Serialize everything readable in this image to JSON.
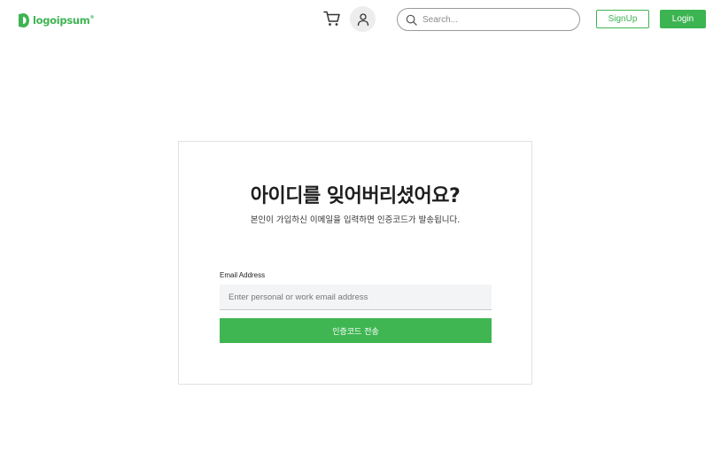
{
  "header": {
    "logo_text": "logoipsum",
    "logo_mark": "®",
    "cart_icon": "cart-icon",
    "user_icon": "user-icon",
    "search": {
      "placeholder": "Search...",
      "value": "",
      "icon": "search-icon"
    },
    "signup_label": "SignUp",
    "login_label": "Login"
  },
  "form": {
    "title": "아이디를 잊어버리셨어요?",
    "subtitle": "본인이 가입하신 이메일을 입력하면 인증코드가 발송됩니다.",
    "email_label": "Email Address",
    "email_placeholder": "Enter personal or work email address",
    "email_value": "",
    "submit_label": "인증코드 전송"
  },
  "colors": {
    "brand_green": "#3db452",
    "border_light": "#e2e2e2",
    "input_bg": "#f3f4f6",
    "avatar_bg": "#ededed"
  }
}
